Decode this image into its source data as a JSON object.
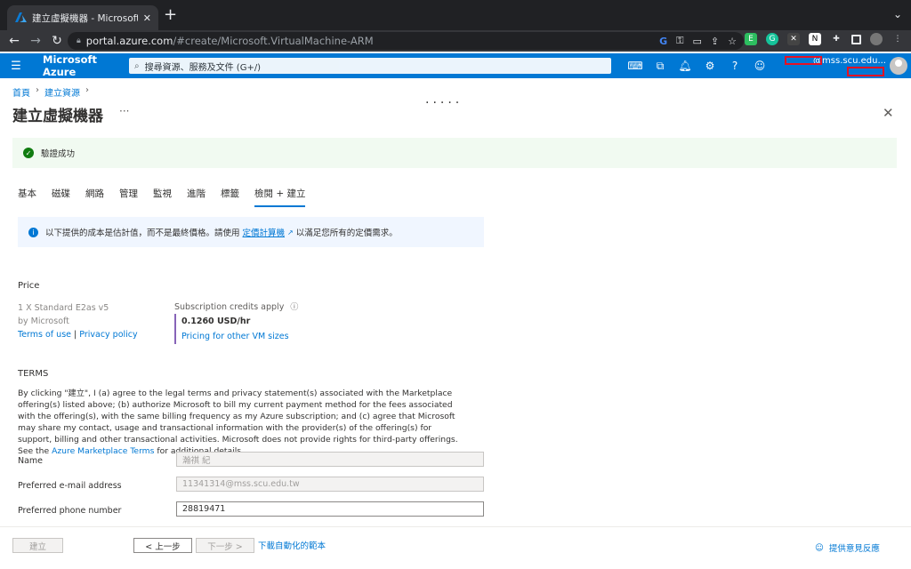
{
  "browser": {
    "tab_title": "建立虛擬機器 - Microsoft Azure",
    "url_host": "portal.azure.com",
    "url_path": "/#create/Microsoft.VirtualMachine-ARM"
  },
  "azure": {
    "brand": "Microsoft Azure",
    "search_placeholder": "搜尋資源、服務及文件 (G+/)",
    "account": "@mss.scu.edu..."
  },
  "breadcrumb": [
    "首頁",
    "建立資源"
  ],
  "page_title": "建立虛擬機器",
  "more": "···",
  "dots": ".....",
  "success_msg": "驗證成功",
  "tabs": [
    "基本",
    "磁碟",
    "網路",
    "管理",
    "監視",
    "進階",
    "標籤",
    "檢閱 + 建立"
  ],
  "info": {
    "text_before": "以下提供的成本是估計值，而不是最終價格。請使用",
    "link": "定價計算機",
    "text_after": "以滿足您所有的定價需求。"
  },
  "price": {
    "heading": "Price",
    "product": "1 X Standard E2as v5",
    "vendor": "by Microsoft",
    "terms_link": "Terms of use",
    "privacy_link": "Privacy policy",
    "sub_label": "Subscription credits apply",
    "amount": "0.1260 USD/hr",
    "other_link": "Pricing for other VM sizes"
  },
  "terms": {
    "heading": "TERMS",
    "body": "By clicking \"建立\", I (a) agree to the legal terms and privacy statement(s) associated with the Marketplace offering(s) listed above; (b) authorize Microsoft to bill my current payment method for the fees associated with the offering(s), with the same billing frequency as my Azure subscription; and (c) agree that Microsoft may share my contact, usage and transactional information with the provider(s) of the offering(s) for support, billing and other transactional activities. Microsoft does not provide rights for third-party offerings. See the",
    "link": "Azure Marketplace Terms",
    "tail": "for additional details."
  },
  "form": {
    "name_label": "Name",
    "name_value": "瀚祺 紀",
    "email_label": "Preferred e-mail address",
    "email_value": "11341314@mss.scu.edu.tw",
    "phone_label": "Preferred phone number",
    "phone_value": "28819471"
  },
  "footer": {
    "create": "建立",
    "prev": "< 上一步",
    "next": "下一步 >",
    "download": "下載自動化的範本",
    "feedback": "提供意見反應"
  },
  "colors": {
    "azure_blue": "#0078d4",
    "success_green": "#107c10",
    "price_accent": "#8764b8"
  }
}
